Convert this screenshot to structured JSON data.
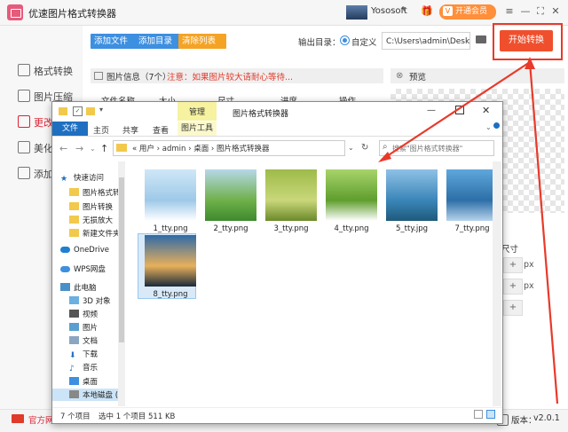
{
  "app": {
    "title": "优速图片格式转换器",
    "user": "Yososoft",
    "user_dropdown": "▾",
    "vip_icon": "V",
    "vip_label": "开通会员",
    "window_controls": [
      "≡",
      "—",
      "⛶",
      "✕"
    ]
  },
  "sidebar": {
    "items": [
      {
        "label": "格式转换",
        "icon": "convert-icon"
      },
      {
        "label": "图片压缩",
        "icon": "compress-icon"
      },
      {
        "label": "更改",
        "icon": "edit-icon"
      },
      {
        "label": "美化",
        "icon": "beautify-icon"
      },
      {
        "label": "添加",
        "icon": "watermark-icon"
      }
    ]
  },
  "toolbar": {
    "add_file": "添加文件",
    "add_dir": "添加目录",
    "clear_list": "清除列表",
    "output_label": "输出目录：",
    "output_option": "自定义",
    "output_path": "C:\\Users\\admin\\Deskto",
    "start": "开始转换"
  },
  "info": {
    "label": "图片信息（7个）",
    "warning": "注意：如果图片较大请耐心等待..."
  },
  "preview": {
    "label": "预览"
  },
  "table_headers": [
    "文件名称",
    "大小",
    "尺寸",
    "进度",
    "操作"
  ],
  "size_panel": {
    "label": "尺寸",
    "unit": "px",
    "plus": "+"
  },
  "bottom": {
    "official_site": "官方网",
    "version_label": "版本：",
    "version": "v2.0.1"
  },
  "explorer": {
    "manage_tab": "管理",
    "title": "图片格式转换器",
    "ribbon": [
      "文件",
      "主页",
      "共享",
      "查看",
      "图片工具"
    ],
    "address": [
      "«",
      "用户",
      "admin",
      "桌面",
      "图片格式转换器"
    ],
    "address_sep": "›",
    "search_placeholder": "搜索\"图片格式转换器\"",
    "nav": [
      {
        "label": "快速访问",
        "icon": "star-icon"
      },
      {
        "label": "图片格式转",
        "icon": "folder-icon"
      },
      {
        "label": "图片转换",
        "icon": "folder-icon"
      },
      {
        "label": "无损放大",
        "icon": "folder-icon"
      },
      {
        "label": "新建文件夹",
        "icon": "folder-icon"
      },
      {
        "label": "OneDrive",
        "icon": "cloud-icon"
      },
      {
        "label": "WPS网盘",
        "icon": "cloud-icon"
      },
      {
        "label": "此电脑",
        "icon": "computer-icon"
      },
      {
        "label": "3D 对象",
        "icon": "3d-icon"
      },
      {
        "label": "视频",
        "icon": "video-icon"
      },
      {
        "label": "图片",
        "icon": "picture-icon"
      },
      {
        "label": "文档",
        "icon": "document-icon"
      },
      {
        "label": "下载",
        "icon": "download-icon"
      },
      {
        "label": "音乐",
        "icon": "music-icon"
      },
      {
        "label": "桌面",
        "icon": "desktop-icon"
      },
      {
        "label": "本地磁盘 (C",
        "icon": "disk-icon"
      }
    ],
    "files": [
      {
        "name": "1_tty.png",
        "colors": [
          "#cfe7f7",
          "#9ec9e8",
          "#ffffff"
        ]
      },
      {
        "name": "2_tty.png",
        "colors": [
          "#b6d8e8",
          "#6fb04a",
          "#3d8a2e"
        ]
      },
      {
        "name": "3_tty.png",
        "colors": [
          "#9dbb4a",
          "#c9d77a",
          "#6b8a2a"
        ]
      },
      {
        "name": "4_tty.png",
        "colors": [
          "#a8d46a",
          "#5f9e2e",
          "#ffffff"
        ]
      },
      {
        "name": "5_tty.jpg",
        "colors": [
          "#8fc1e6",
          "#3a86b8",
          "#1f5a7a"
        ]
      },
      {
        "name": "7_tty.png",
        "colors": [
          "#5fa7dc",
          "#2d6fa8",
          "#b8d3ec"
        ]
      },
      {
        "name": "8_tty.png",
        "colors": [
          "#2f6aa8",
          "#e8b05a",
          "#1a2a3a"
        ]
      }
    ],
    "status_count": "7 个项目",
    "status_selected": "选中 1 个项目  511 KB"
  },
  "colors": {
    "accent": "#3d8fe0",
    "start": "#f04f2d",
    "arrow": "#e83a2a",
    "warning": "#e03a2a"
  }
}
